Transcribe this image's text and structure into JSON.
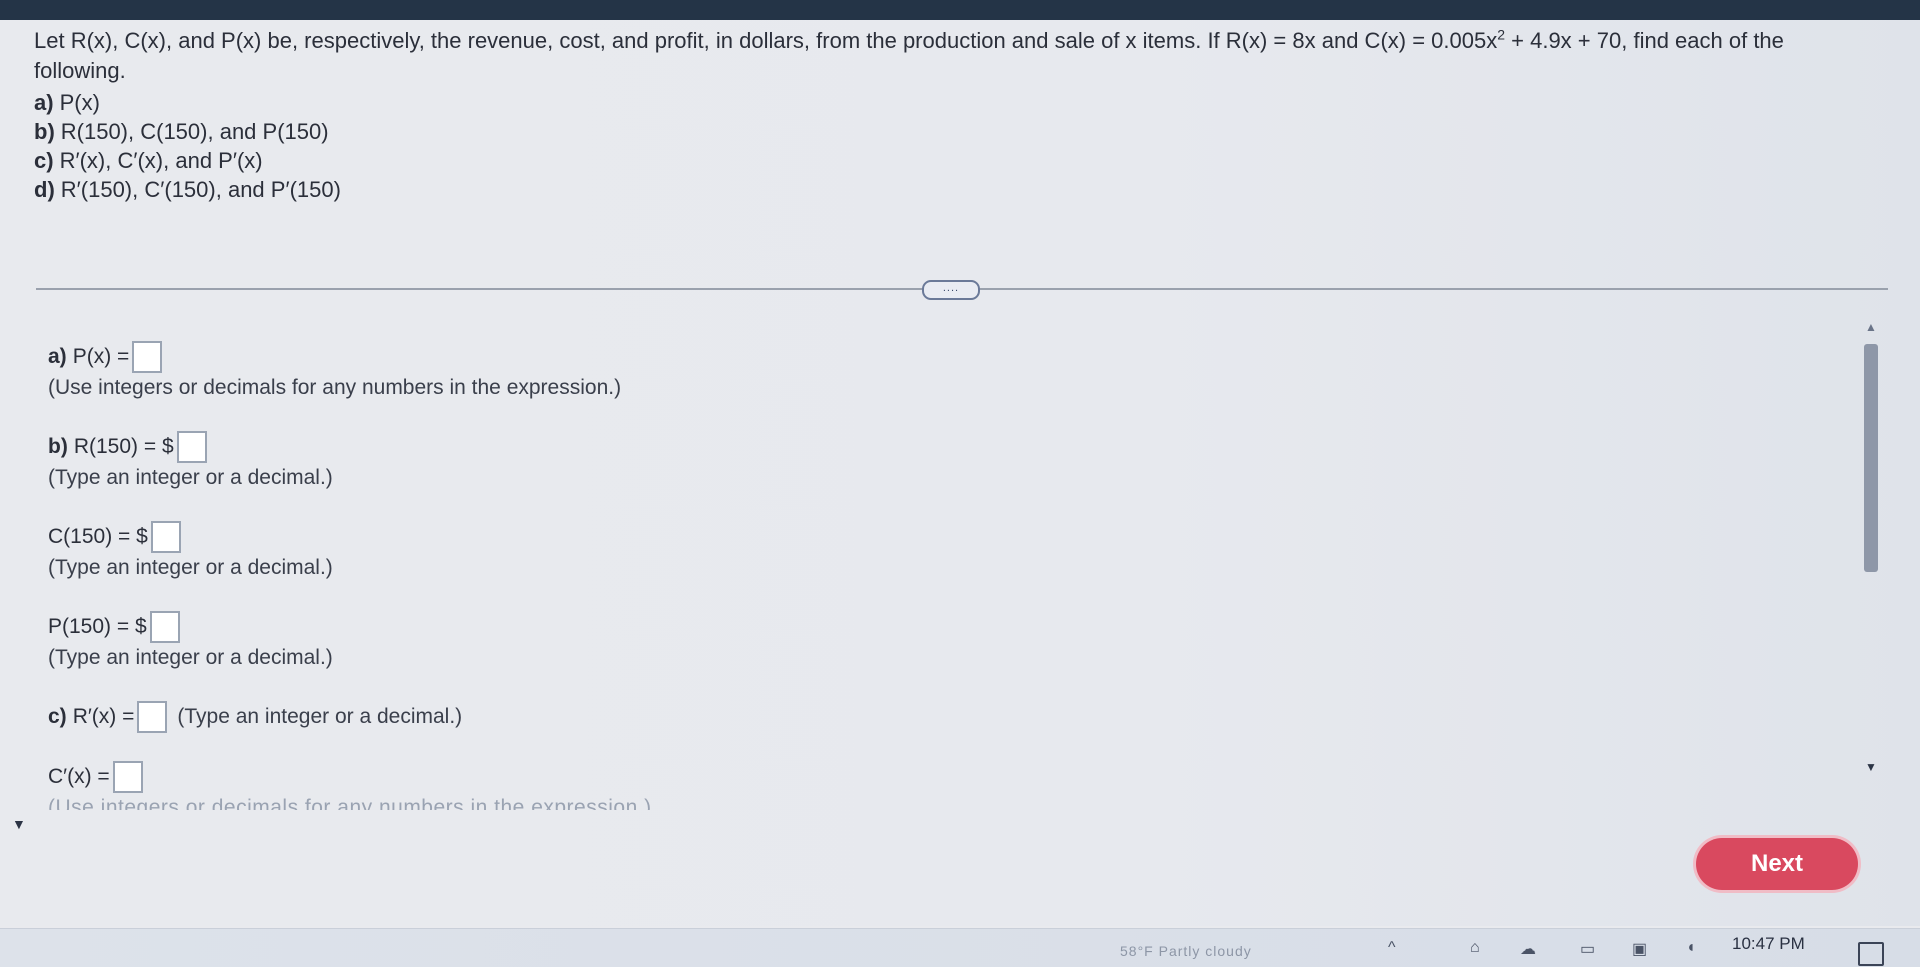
{
  "question": {
    "statement_a": "Let R(x), C(x), and P(x) be, respectively, the revenue, cost, and profit, in dollars, from the production and sale of x items. If R(x) = 8x and C(x) = 0.005x",
    "exponent": "2",
    "statement_b": " + 4.9x + 70, find each of the following.",
    "parts": [
      {
        "label": "a)",
        "text": "P(x)"
      },
      {
        "label": "b)",
        "text": "R(150), C(150), and P(150)"
      },
      {
        "label": "c)",
        "text": "R′(x), C′(x), and P′(x)"
      },
      {
        "label": "d)",
        "text": "R′(150), C′(150), and P′(150)"
      }
    ]
  },
  "more_button": "....",
  "answers": {
    "a_label": "a)",
    "a_expr": "P(x) =",
    "a_hint": "(Use integers or decimals for any numbers in the expression.)",
    "b_label": "b)",
    "b_expr": "R(150) = $",
    "b_hint": "(Type an integer or a decimal.)",
    "c150_expr": "C(150) = $",
    "c150_hint": "(Type an integer or a decimal.)",
    "p150_expr": "P(150) = $",
    "p150_hint": "(Type an integer or a decimal.)",
    "c_label": "c)",
    "rprime_expr": "R′(x) =",
    "rprime_hint": "(Type an integer or a decimal.)",
    "cprime_expr": "C′(x) =",
    "cprime_hint": "(Use integers or decimals for any numbers in the expression.)"
  },
  "next_button": "Next",
  "taskbar": {
    "weather": "58°F Partly cloudy",
    "clock": "10:47 PM"
  },
  "colors": {
    "accent": "#d9495f",
    "topbar": "#243447"
  }
}
